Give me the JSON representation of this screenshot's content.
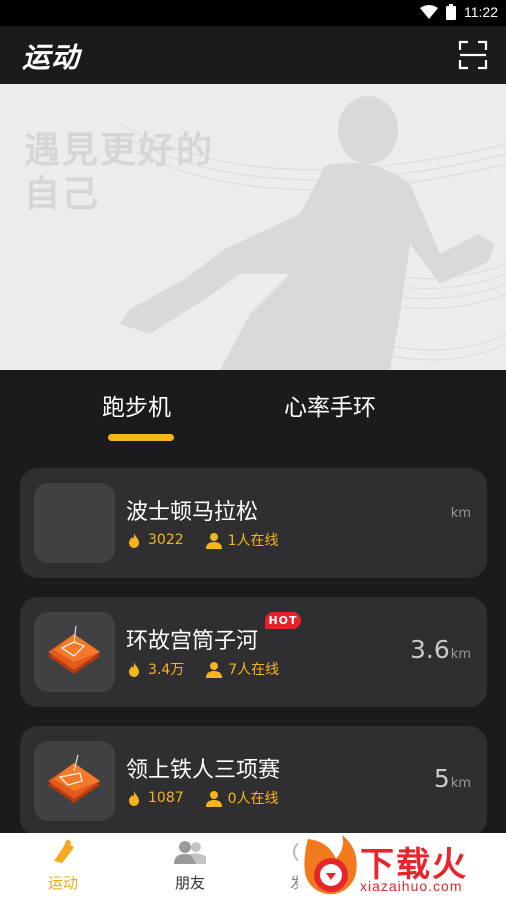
{
  "status_bar": {
    "time": "11:22"
  },
  "header": {
    "title": "运动"
  },
  "banner": {
    "slogan_line1": "遇見更好的",
    "slogan_line2": "自己"
  },
  "tabs": [
    {
      "label": "跑步机",
      "active": true
    },
    {
      "label": "心率手环",
      "active": false
    }
  ],
  "cards": [
    {
      "title": "波士顿马拉松",
      "heat": "3022",
      "online": "1人在线",
      "distance": "",
      "unit": "km",
      "hot": false
    },
    {
      "title": "环故宫筒子河",
      "heat": "3.4万",
      "online": "7人在线",
      "distance": "3.6",
      "unit": "km",
      "hot": true,
      "badge": "HOT"
    },
    {
      "title": "领上铁人三项赛",
      "heat": "1087",
      "online": "0人在线",
      "distance": "5",
      "unit": "km",
      "hot": false
    }
  ],
  "bottom_nav": [
    {
      "label": "运动",
      "icon": "run-icon",
      "active": true
    },
    {
      "label": "朋友",
      "icon": "friends-icon",
      "active": false
    },
    {
      "label": "发现",
      "icon": "discover-icon",
      "active": false
    }
  ],
  "watermark": {
    "brand": "下载火",
    "domain": "xiazaihuo.com"
  },
  "colors": {
    "accent": "#f7b51c",
    "card_bg": "#2f2f31",
    "page_bg": "#1b1b1d",
    "hot": "#e8202a"
  }
}
